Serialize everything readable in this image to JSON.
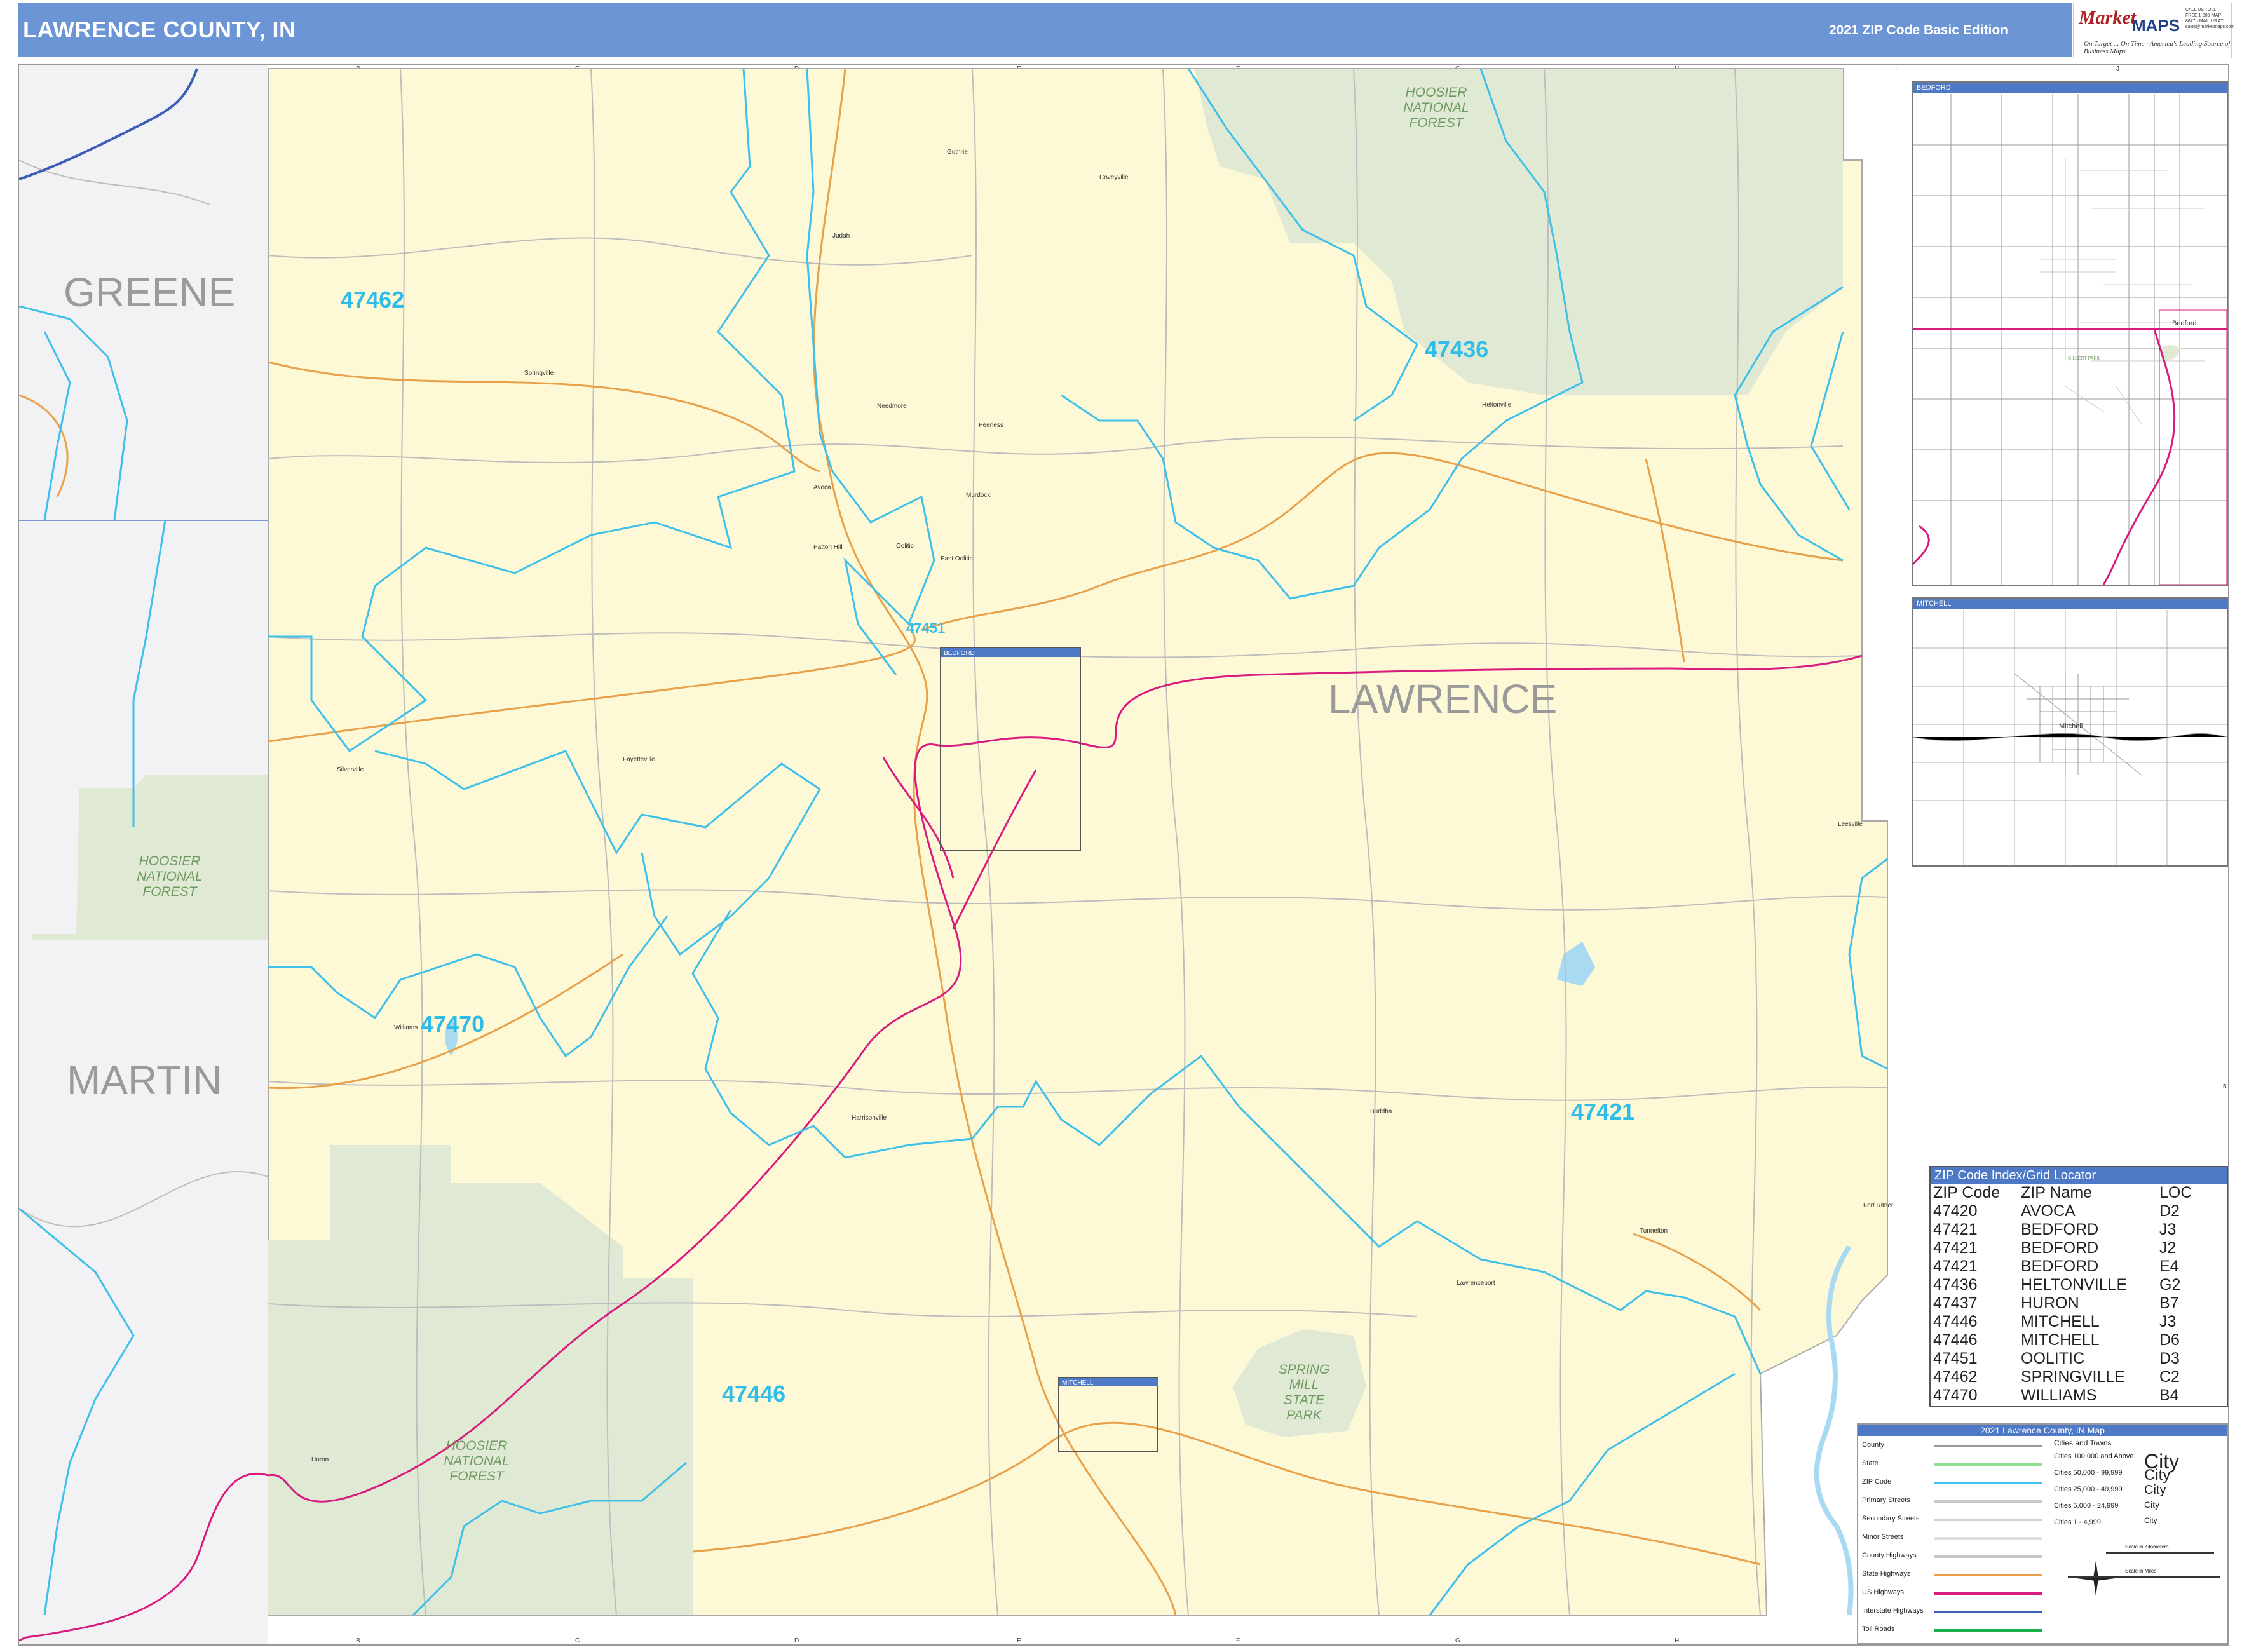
{
  "header": {
    "title": "LAWRENCE COUNTY, IN",
    "edition": "2021 ZIP Code Basic Edition"
  },
  "logo": {
    "brand_script": "Market",
    "brand_maps": "MAPS",
    "tagline1": "On Target ... On Time",
    "tagline2": "America's Leading Source of Business Maps",
    "contact": "CALL US TOLL FREE 1-800-MAP-8677 · MAIL US AT sales@marketmaps.com"
  },
  "grid": {
    "columns": [
      "A",
      "B",
      "C",
      "D",
      "E",
      "F",
      "G",
      "H",
      "I",
      "J"
    ],
    "rows": [
      "1",
      "2",
      "3",
      "4",
      "5",
      "6",
      "7"
    ]
  },
  "counties": {
    "greene": "GREENE",
    "martin": "MARTIN",
    "lawrence": "LAWRENCE"
  },
  "forests": {
    "north": [
      "HOOSIER",
      "NATIONAL",
      "FOREST"
    ],
    "west": [
      "HOOSIER",
      "NATIONAL",
      "FOREST"
    ],
    "south": [
      "HOOSIER",
      "NATIONAL",
      "FOREST"
    ],
    "park": [
      "SPRING",
      "MILL",
      "STATE",
      "PARK"
    ]
  },
  "zips": {
    "z47462": "47462",
    "z47436": "47436",
    "z47451": "47451",
    "z47470": "47470",
    "z47421": "47421",
    "z47446": "47446"
  },
  "places": {
    "guthrie": "Guthrie",
    "coveyville": "Coveyville",
    "judah": "Judah",
    "springville": "Springville",
    "needmore": "Needmore",
    "peerless": "Peerless",
    "heltonville": "Heltonville",
    "avoca": "Avoca",
    "murdock": "Murdock",
    "patton_hill": "Patton Hill",
    "oolitic": "Oolitic",
    "east_oolitic": "East Oolitic",
    "silverville": "Silverville",
    "fayetteville": "Fayetteville",
    "leesville": "Leesville",
    "williams": "Williams",
    "huron": "Huron",
    "harrisonville": "Harrisonville",
    "buddha": "Buddha",
    "tunnelton": "Tunnelton",
    "fort_ritner": "Fort Ritner",
    "lawrenceport": "Lawrenceport",
    "bedford": "Bedford",
    "mitchell": "Mitchell"
  },
  "insets": {
    "bedford_box": "BEDFORD",
    "mitchell_box": "MITCHELL",
    "bedford_panel": "BEDFORD",
    "mitchell_panel": "MITCHELL",
    "bedford_park": "GILBERT PARK"
  },
  "zip_index": {
    "heading": "ZIP Code Index/Grid Locator",
    "columns": [
      "ZIP Code",
      "ZIP Name",
      "LOC"
    ],
    "rows": [
      [
        "47420",
        "AVOCA",
        "D2"
      ],
      [
        "47421",
        "BEDFORD",
        "J3"
      ],
      [
        "47421",
        "BEDFORD",
        "J2"
      ],
      [
        "47421",
        "BEDFORD",
        "E4"
      ],
      [
        "47436",
        "HELTONVILLE",
        "G2"
      ],
      [
        "47437",
        "HURON",
        "B7"
      ],
      [
        "47446",
        "MITCHELL",
        "J3"
      ],
      [
        "47446",
        "MITCHELL",
        "D6"
      ],
      [
        "47451",
        "OOLITIC",
        "D3"
      ],
      [
        "47462",
        "SPRINGVILLE",
        "C2"
      ],
      [
        "47470",
        "WILLIAMS",
        "B4"
      ]
    ]
  },
  "legend": {
    "heading": "2021 Lawrence County, IN Map",
    "items": [
      "County",
      "State",
      "ZIP Code",
      "Primary Streets",
      "Secondary Streets",
      "Minor Streets",
      "County Highways",
      "State Highways",
      "US Highways",
      "Interstate Highways",
      "Toll Roads"
    ],
    "cities_heading": "Cities and Towns",
    "cities": [
      {
        "range": "Cities 100,000 and Above",
        "sample": "City"
      },
      {
        "range": "Cities 50,000 - 99,999",
        "sample": "City"
      },
      {
        "range": "Cities 25,000 - 49,999",
        "sample": "City"
      },
      {
        "range": "Cities 5,000 - 24,999",
        "sample": "City"
      },
      {
        "range": "Cities 1 - 4,999",
        "sample": "City"
      }
    ],
    "scale_km": "Scale in Kilometers",
    "scale_mi": "Scale in Miles"
  },
  "colors": {
    "header": "#6b95d4",
    "county_fill": "#fdf9d6",
    "neighbor_fill": "#f2f2f4",
    "forest_fill": "#dfe9d4",
    "zip_line": "#3fc0ea",
    "zip_label": "#2fbce8",
    "us_highway": "#d81b7f",
    "state_highway": "#e8a04a",
    "water": "#a9daf2"
  }
}
